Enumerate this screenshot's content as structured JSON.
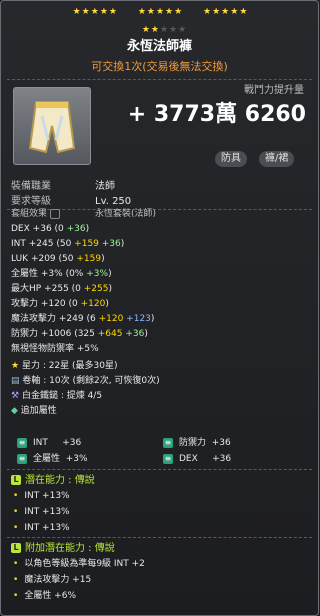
{
  "stars": {
    "row1": [
      "★★★★★",
      "★★★★★",
      "★★★★★"
    ],
    "row2_on": "★★",
    "row2_off": "★★★"
  },
  "item": {
    "name": "永恆法師褲",
    "trade_note": "可交換1次(交易後無法交換)",
    "cp_label": "戰鬥力提升量",
    "cp_value": "+ 3773萬 6260",
    "tags": [
      "防具",
      "褲/裙"
    ],
    "req_job_label": "裝備職業",
    "req_job": "法師",
    "req_level_label": "要求等級",
    "req_level": "Lv. 250"
  },
  "set": {
    "label": "套組效果",
    "name": "永恆套裝(法師)"
  },
  "stats": [
    {
      "k": "DEX",
      "v": "+36 (0 ",
      "a": "+36",
      "b": ")"
    },
    {
      "k": "INT",
      "v": "+245 (50 ",
      "a": "+159",
      "a2": " +36",
      "b": ")"
    },
    {
      "k": "LUK",
      "v": "+209 (50 ",
      "a": "+159",
      "b": ")"
    },
    {
      "k": "全屬性",
      "v": "+3% (0% ",
      "a": "+3%",
      "b": ")"
    },
    {
      "k": "最大HP",
      "v": "+255 (0 ",
      "a": "+255",
      "b": ")"
    },
    {
      "k": "攻擊力",
      "v": "+120 (0 ",
      "a": "+120",
      "b": ")"
    },
    {
      "k": "魔法攻擊力",
      "v": "+249 (6 ",
      "a": "+120",
      "a2": " +123",
      "b": ")"
    },
    {
      "k": "防禦力",
      "v": "+1006 (325 ",
      "a": "+645",
      "a2": " +36",
      "b": ")"
    },
    {
      "k": "無視怪物防禦率",
      "v": "+5%",
      "a": "",
      "b": ""
    }
  ],
  "starforce": "星力 : 22星 (最多30星)",
  "scroll": "卷軸 : 10次 (剩餘2次, 可恢復0次)",
  "hammer": "白金鐵鎚 : 提煉 4/5",
  "bonus_label": "追加屬性",
  "bonus": [
    {
      "k": "INT",
      "v": "+36"
    },
    {
      "k": "防禦力",
      "v": "+36"
    },
    {
      "k": "全屬性",
      "v": "+3%"
    },
    {
      "k": "DEX",
      "v": "+36"
    }
  ],
  "potential": {
    "title": "潛在能力 : 傳說",
    "lines": [
      "INT +13%",
      "INT +13%",
      "INT +13%"
    ]
  },
  "add_potential": {
    "title": "附加潛在能力 : 傳說",
    "lines": [
      "以角色等級為準每9級 INT +2",
      "魔法攻擊力 +15",
      "全屬性 +6%"
    ]
  },
  "colors": {
    "gold": "#ffd800",
    "green": "#9df59a",
    "blue": "#91b7ff",
    "orange": "#f29a3c",
    "lime": "#b8e639"
  }
}
